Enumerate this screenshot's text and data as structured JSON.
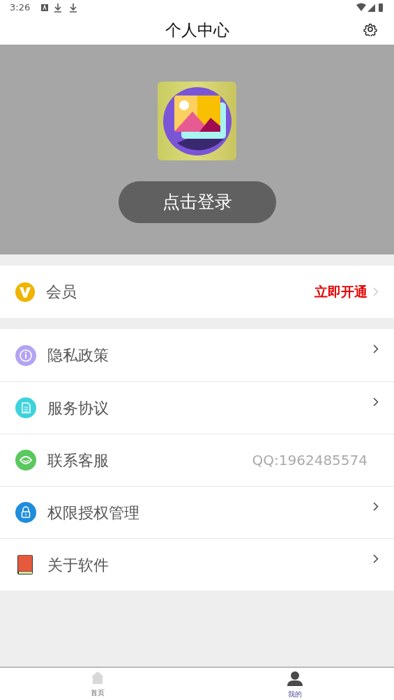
{
  "status_bar": {
    "time": "3:26"
  },
  "header": {
    "title": "个人中心"
  },
  "profile": {
    "login_button": "点击登录"
  },
  "member": {
    "label": "会员",
    "action": "立即开通"
  },
  "menu": [
    {
      "kind": "link",
      "label": "隐私政策"
    },
    {
      "kind": "link",
      "label": "服务协议"
    },
    {
      "kind": "contact",
      "label": "联系客服",
      "value": "QQ:1962485574"
    },
    {
      "kind": "link",
      "label": "权限授权管理"
    },
    {
      "kind": "link",
      "label": "关于软件"
    }
  ],
  "tab_bar": [
    {
      "label": "首页",
      "selected": false
    },
    {
      "label": "我的",
      "selected": true
    }
  ]
}
